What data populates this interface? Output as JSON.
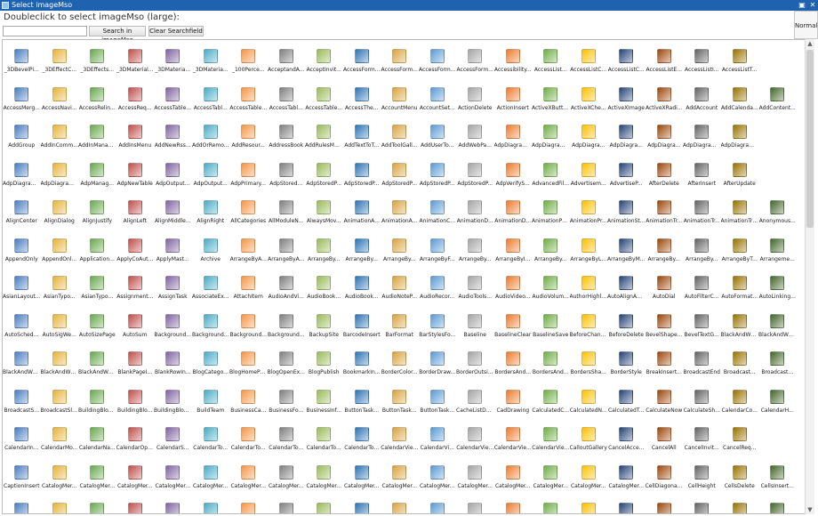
{
  "window": {
    "title": "Select imageMso",
    "restore_glyph": "▣",
    "close_glyph": "✕"
  },
  "header": {
    "instruction": "Doubleclick to select imageMso (large):",
    "search": {
      "value": "",
      "placeholder": ""
    },
    "search_button": "Search in imageMso",
    "clear_button": "Clear Searchfield",
    "size_label": "Normal"
  },
  "icons": [
    "_3DBevelPi...",
    "_3DEffectC...",
    "_3DEffects...",
    "_3DMaterial...",
    "_3DMateria...",
    "_3DMateria...",
    "_100Perce...",
    "AcceptandA...",
    "AcceptInvit...",
    "AccessForm...",
    "AccessForm...",
    "AccessForm...",
    "AccessForm...",
    "Accessibility...",
    "AccessList...",
    "AccessListC...",
    "AccessListC...",
    "AccessListE...",
    "AccessListI...",
    "AccessListT...",
    "",
    "AccessMerg...",
    "AccessNavi...",
    "AccessRelin...",
    "AccessReq...",
    "AccessTable...",
    "AccessTabl...",
    "AccessTable...",
    "AccessTabl...",
    "AccessTable...",
    "AccessThe...",
    "AccountMenu",
    "AccountSet...",
    "ActionDelete",
    "ActionInsert",
    "ActiveXButton",
    "ActiveXChe...",
    "ActiveXImage",
    "ActiveXRadi...",
    "AddAccount",
    "AddCalenda...",
    "AddContent...",
    "AddGroup",
    "AddInComm...",
    "AddInManager",
    "AddInsMenu",
    "AddNewRss...",
    "AddOrRemo...",
    "AddResour...",
    "AddressBook",
    "AddRulesMenu",
    "AddTextToT...",
    "AddToolGall...",
    "AddUserTo...",
    "AddWebPa...",
    "AdpDiagram...",
    "AdpDiagram...",
    "AdpDiagra...",
    "AdpDiagra...",
    "AdpDiagra...",
    "AdpDiagram...",
    "AdpDiagram...",
    "",
    "AdpDiagram...",
    "AdpDiagram...",
    "AdpManag...",
    "AdpNewTable",
    "AdpOutput...",
    "AdpOutput...",
    "AdpPrimary...",
    "AdpStored...",
    "AdpStoredP...",
    "AdpStoredP...",
    "AdpStoredP...",
    "AdpStoredP...",
    "AdpStoredP...",
    "AdpVerifyS...",
    "AdvancedFil...",
    "Advertisem...",
    "AdvertiseP...",
    "AfterDelete",
    "AfterInsert",
    "AfterUpdate",
    "",
    "AlignCenter",
    "AlignDialog",
    "AlignJustify",
    "AlignLeft",
    "AlignMiddle...",
    "AlignRight",
    "AllCategories",
    "AllModuleN...",
    "AlwaysMov...",
    "AnimationA...",
    "AnimationA...",
    "AnimationC...",
    "AnimationD...",
    "AnimationD...",
    "AnimationPa...",
    "AnimationPr...",
    "AnimationSt...",
    "AnimationTr...",
    "AnimationTr...",
    "AnimationTri...",
    "Anonymous...",
    "AppendOnly",
    "AppendOnl...",
    "Application...",
    "ApplyCoAut...",
    "ApplyMast...",
    "Archive",
    "ArrangeByA...",
    "ArrangeByA...",
    "ArrangeBy...",
    "ArrangeBy...",
    "ArrangeBy...",
    "ArrangeByF...",
    "ArrangeBy...",
    "ArrangeByI...",
    "ArrangeBy...",
    "ArrangeByL...",
    "ArrangeByM...",
    "ArrangeBy...",
    "ArrangeBy...",
    "ArrangeByT...",
    "Arrangeme...",
    "AsianLayout...",
    "AsianTypo...",
    "AsianTypo...",
    "Assignment...",
    "AssignTask",
    "AssociateEx...",
    "AttachItem",
    "AudioAndVi...",
    "AudioBook...",
    "AudioBook...",
    "AudioNoteP...",
    "AudioRecor...",
    "AudioTools...",
    "AudioVideo...",
    "AudioVolum...",
    "AuthorHighli...",
    "AutoAlignAn...",
    "AutoDial",
    "AutoFilterC...",
    "AutoFormat...",
    "AutoLinking...",
    "AutoSched...",
    "AutoSigWe...",
    "AutoSizePage",
    "AutoSum",
    "Background...",
    "Background...",
    "Background...",
    "Background...",
    "BackupSite",
    "BarcodeInsert",
    "BarFormat",
    "BarStylesFo...",
    "Baseline",
    "BaselineClear",
    "BaselineSave",
    "BeforeChange",
    "BeforeDelete",
    "BevelShape...",
    "BevelTextG...",
    "BlackAndWh...",
    "BlackAndWh...",
    "BlackAndWh...",
    "BlackAndWh...",
    "BlackAndWh...",
    "BlankPageI...",
    "BlankRowIn...",
    "BlogCatego...",
    "BlogHomePage",
    "BlogOpenEx...",
    "BlogPublish",
    "BookmarkIn...",
    "BorderColor...",
    "BorderDraw...",
    "BorderOutside",
    "BordersAnd...",
    "BordersAnd...",
    "BordersSha...",
    "BorderStyle",
    "BreakInsert...",
    "BroadcastEnd",
    "Broadcast...",
    "Broadcast...",
    "BroadcastS...",
    "BroadcastSli...",
    "BuildingBloc...",
    "BuildingBlo...",
    "BuildingBloc...",
    "BuildTeam",
    "BusinessCa...",
    "BusinessFo...",
    "BusinessInf...",
    "ButtonTask...",
    "ButtonTask...",
    "ButtonTask...",
    "CacheListData",
    "CadDrawing",
    "CalculatedC...",
    "CalculatedN...",
    "CalculatedT...",
    "CalculateNow",
    "CalculateSh...",
    "CalendarCo...",
    "CalendarH...",
    "CalendarIn...",
    "CalendarMo...",
    "CalendarNa...",
    "CalendarOpen",
    "CalendarS...",
    "CalendarTo...",
    "CalendarTo...",
    "CalendarTo...",
    "CalendarTo...",
    "CalendarTo...",
    "CalendarVie...",
    "CalendarVi...",
    "CalendarVie...",
    "CalendarVie...",
    "CalendarVie...",
    "CalloutGallery",
    "CancelAcce...",
    "CancelAll",
    "CancelInvit...",
    "CancelReq...",
    "",
    "CaptionInsert",
    "CatalogMer...",
    "CatalogMer...",
    "CatalogMer...",
    "CatalogMer...",
    "CatalogMer...",
    "CatalogMer...",
    "CatalogMer...",
    "CatalogMer...",
    "CatalogMer...",
    "CatalogMer...",
    "CatalogMer...",
    "CatalogMer...",
    "CatalogMer...",
    "CatalogMer...",
    "CatalogMer...",
    "CatalogMer...",
    "CellDiagonal...",
    "CellHeight",
    "CellsDelete",
    "CellsInsert...",
    "",
    "",
    "",
    "",
    "",
    "",
    "",
    "",
    "",
    "",
    "",
    "",
    "",
    "",
    "",
    "",
    "",
    "",
    "",
    "",
    ""
  ],
  "icon_colors": [
    "#4a7fc1",
    "#e6b43c",
    "#6aa84f",
    "#c0504d",
    "#8064a2",
    "#4bacc6",
    "#f79646",
    "#7f7f7f",
    "#9bbb59",
    "#2e75b6",
    "#d9a441",
    "#5b9bd5",
    "#a5a5a5",
    "#ed7d31",
    "#70ad47",
    "#ffc000",
    "#264478",
    "#9e480e",
    "#636363",
    "#997300",
    "#43682b"
  ],
  "scrollbar": {
    "up": "▲",
    "down": "▼"
  }
}
